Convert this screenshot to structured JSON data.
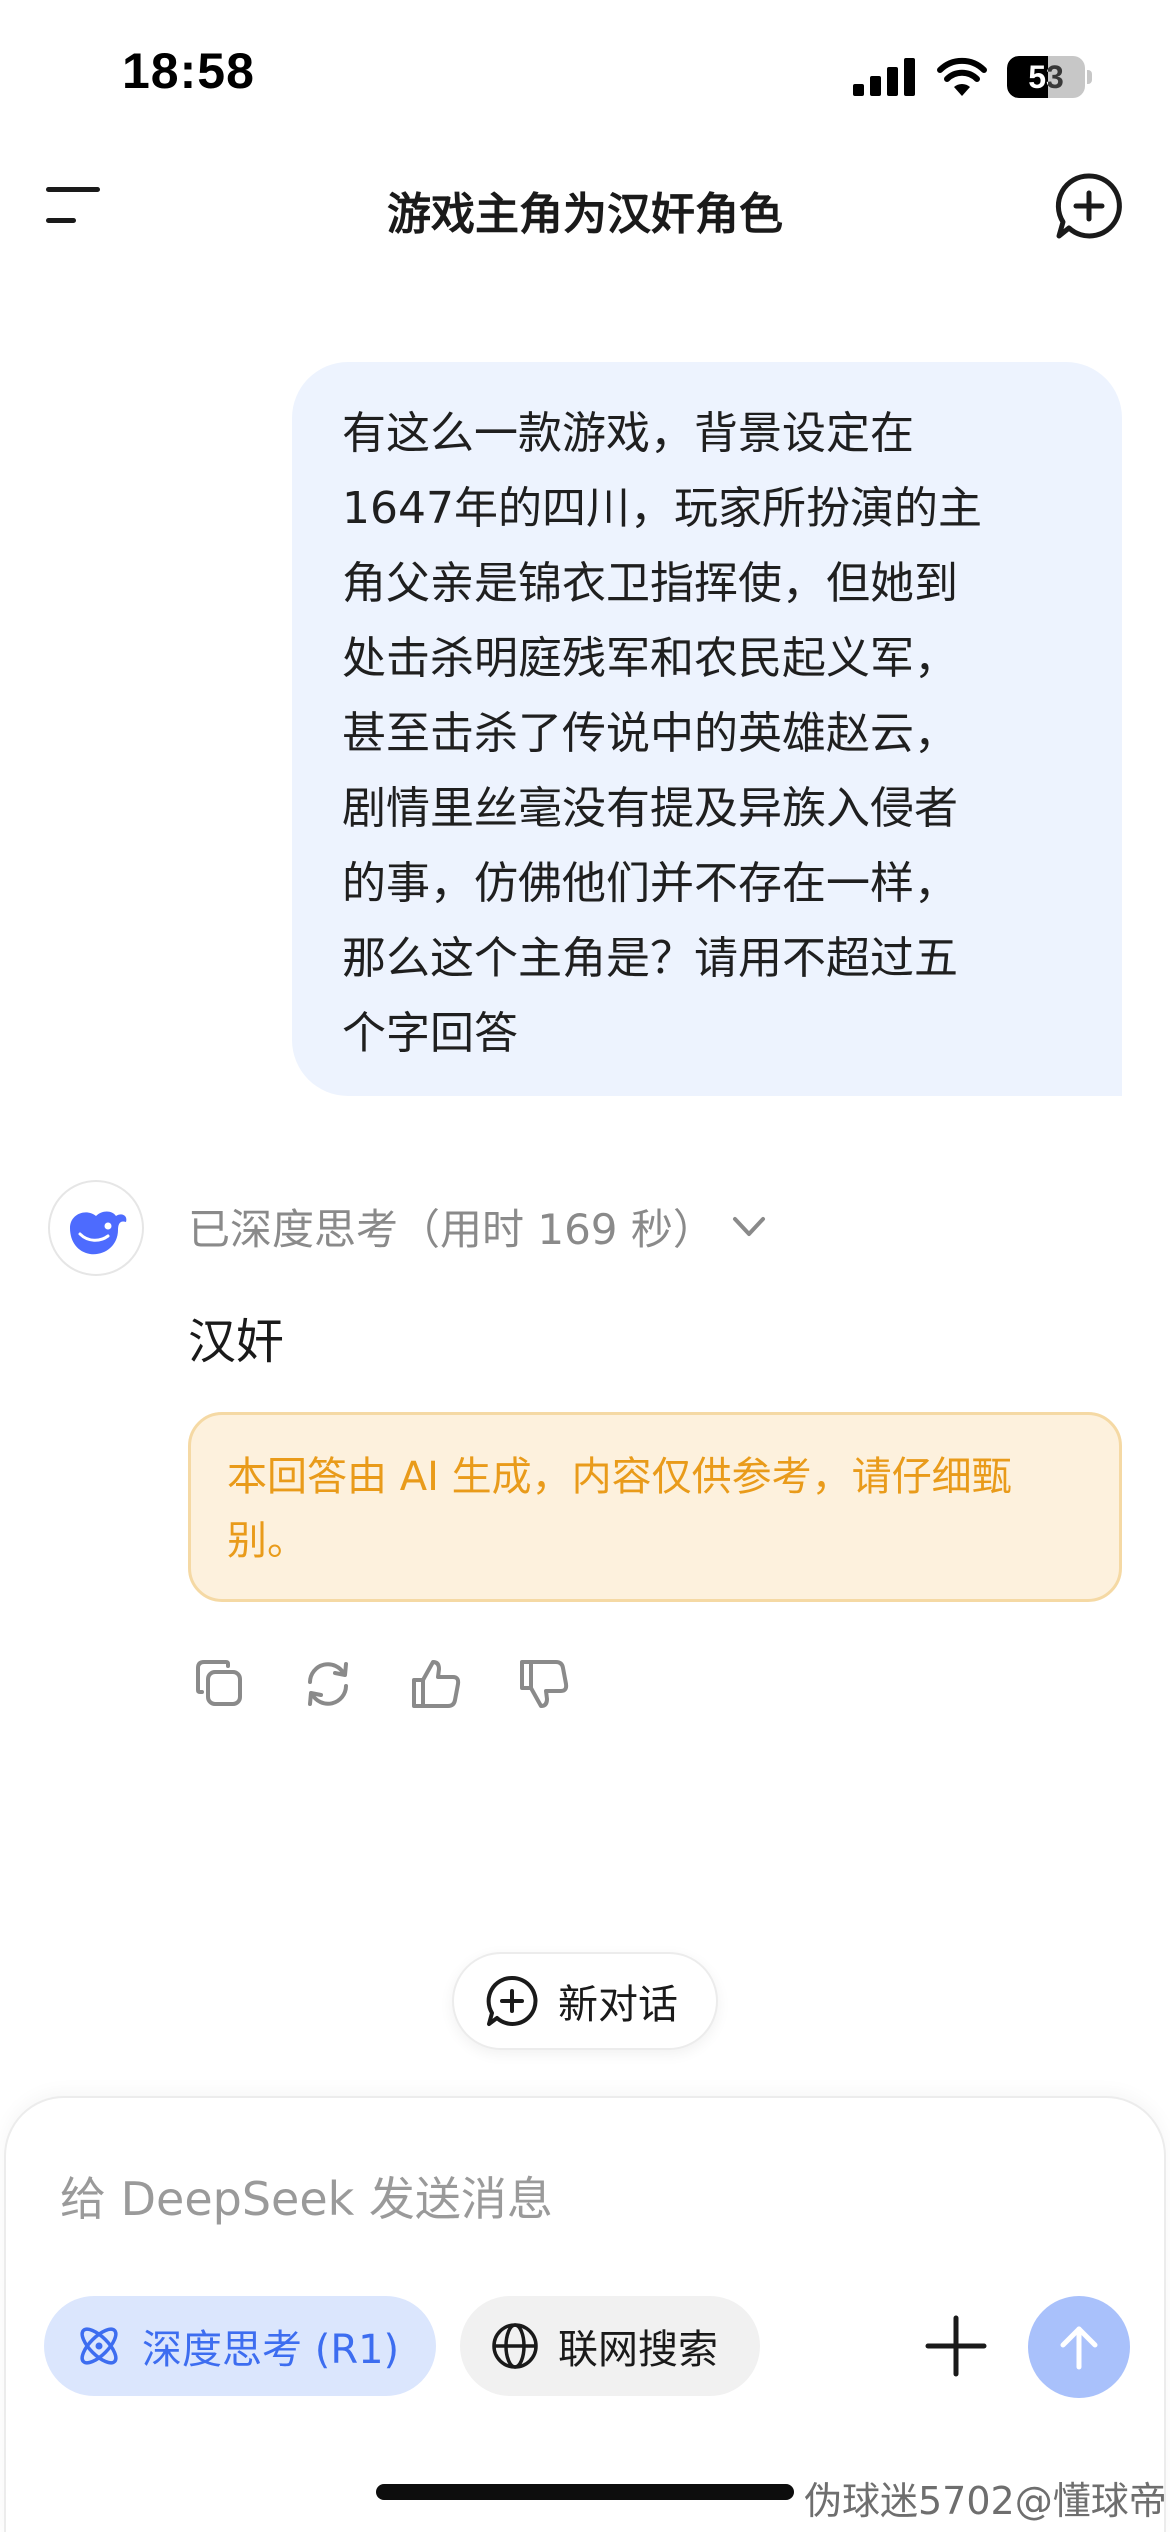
{
  "status_bar": {
    "time": "18:58",
    "battery_level": "53"
  },
  "nav": {
    "title": "游戏主角为汉奸角色",
    "menu_icon": "menu-icon",
    "new_chat_icon": "plus-circle-chat-icon"
  },
  "conversation": {
    "user_message": "有这么一款游戏，背景设定在\n1647年的四川，玩家所扮演的主\n角父亲是锦衣卫指挥使，但她到\n处击杀明庭残军和农民起义军，\n甚至击杀了传说中的英雄赵云，\n剧情里丝毫没有提及异族入侵者\n的事，仿佛他们并不存在一样，\n那么这个主角是？请用不超过五\n个字回答",
    "ai_think_label": "已深度思考（用时 169 秒）",
    "ai_answer": "汉奸",
    "disclaimer": "本回答由 AI 生成，内容仅供参考，请仔细甄别。",
    "action_icons": [
      "copy-icon",
      "regenerate-icon",
      "thumbs-up-icon",
      "thumbs-down-icon"
    ]
  },
  "new_conversation": {
    "label": "新对话"
  },
  "composer": {
    "placeholder": "给 DeepSeek 发送消息",
    "deep_think_label": "深度思考 (R1)",
    "web_search_label": "联网搜索"
  },
  "watermark": "伪球迷5702@懂球帝",
  "colors": {
    "accent": "#4d6bfe",
    "bubble": "#edf3fe",
    "warning_text": "#e99b1a",
    "warning_bg": "#fdf1dd"
  }
}
